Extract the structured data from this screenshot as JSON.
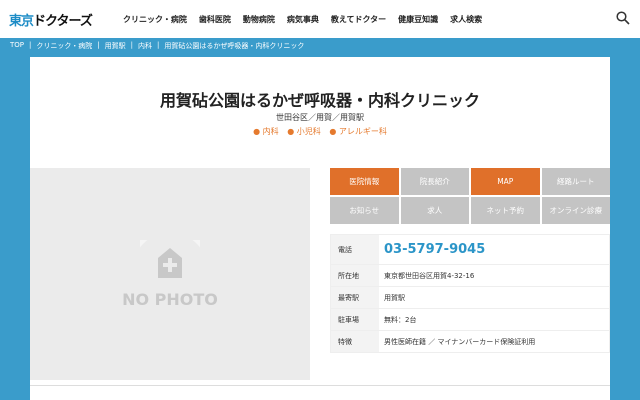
{
  "header": {
    "logo_a": "東京",
    "logo_b": "ドクターズ",
    "nav": [
      "クリニック・病院",
      "歯科医院",
      "動物病院",
      "病気事典",
      "教えてドクター",
      "健康豆知識",
      "求人検索"
    ]
  },
  "breadcrumb": [
    "TOP",
    "|",
    "クリニック・病院",
    "|",
    "用賀駅",
    "|",
    "内科",
    "|",
    "用賀砧公園はるかぜ呼吸器・内科クリニック"
  ],
  "clinic": {
    "title": "用賀砧公園はるかぜ呼吸器・内科クリニック",
    "area": "世田谷区／用賀／用賀駅",
    "tags": [
      "● 内科",
      "● 小児科",
      "● アレルギー科"
    ]
  },
  "photo": {
    "label": "NO PHOTO"
  },
  "buttons": [
    {
      "label": "医院情報",
      "active": true
    },
    {
      "label": "院長紹介",
      "active": false
    },
    {
      "label": "MAP",
      "active": true
    },
    {
      "label": "経路ルート",
      "active": false
    },
    {
      "label": "お知らせ",
      "active": false
    },
    {
      "label": "求人",
      "active": false
    },
    {
      "label": "ネット予約",
      "active": false
    },
    {
      "label": "オンライン診療",
      "active": false
    }
  ],
  "info": [
    {
      "key": "電話",
      "value": "03-5797-9045"
    },
    {
      "key": "所在地",
      "value": "東京都世田谷区用賀4-32-16"
    },
    {
      "key": "最寄駅",
      "value": "用賀駅"
    },
    {
      "key": "駐車場",
      "value": "無料：2台"
    },
    {
      "key": "特徴",
      "value": "男性医師在籍 ／ マイナンバーカード保険証利用"
    }
  ],
  "colors": {
    "accent": "#e0702a",
    "blue": "#3a9ccb"
  }
}
